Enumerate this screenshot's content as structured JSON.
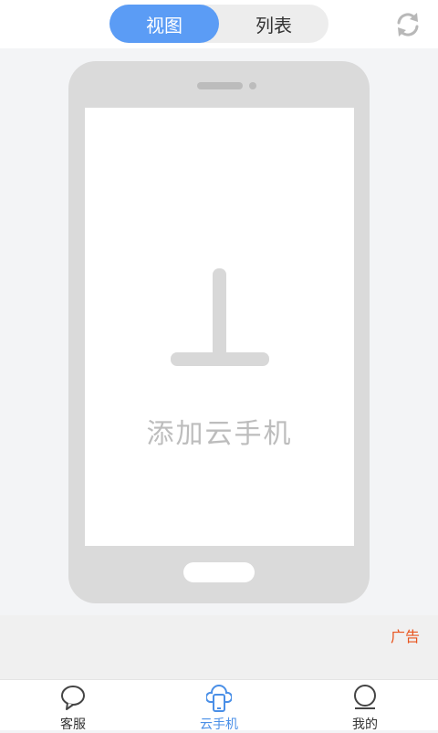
{
  "header": {
    "segment": [
      {
        "label": "视图",
        "active": true
      },
      {
        "label": "列表",
        "active": false
      }
    ],
    "refresh_icon": "refresh-icon"
  },
  "main": {
    "add_label": "添加云手机",
    "add_icon": "plus-icon"
  },
  "ad": {
    "label": "广告"
  },
  "tabbar": {
    "items": [
      {
        "label": "客服",
        "icon": "chat-bubble-icon",
        "active": false
      },
      {
        "label": "云手机",
        "icon": "cloud-phone-icon",
        "active": true
      },
      {
        "label": "我的",
        "icon": "profile-icon",
        "active": false
      }
    ]
  },
  "colors": {
    "accent": "#5b9cf5",
    "ad": "#e8531c",
    "phone_frame": "#dadada"
  }
}
